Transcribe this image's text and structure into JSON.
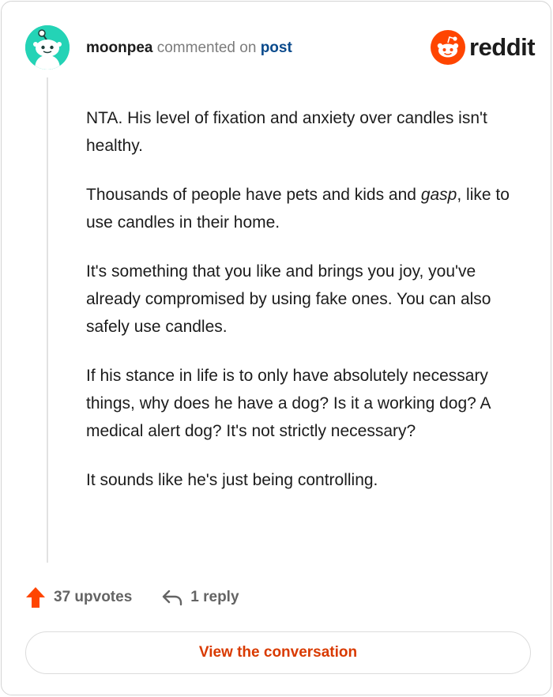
{
  "header": {
    "username": "moonpea",
    "action_text": "commented on",
    "target_link": "post",
    "brand": "reddit"
  },
  "colors": {
    "avatar_bg": "#24d3b6",
    "brand_orange": "#ff4500",
    "upvote": "#ff4500",
    "button_text": "#d93a00",
    "link": "#0a4a8c"
  },
  "icons": {
    "avatar": "snoo-avatar-icon",
    "logo": "reddit-snoo-icon",
    "upvote": "arrow-up-icon",
    "reply": "reply-arrow-icon"
  },
  "comment": {
    "p1": "NTA. His level of fixation and anxiety over candles isn't healthy.",
    "p2_pre": "Thousands of people have pets and kids and ",
    "p2_em": "gasp",
    "p2_post": ", like to use candles in their home.",
    "p3": "It's something that you like and brings you joy, you've already compromised by using fake ones. You can also safely use candles.",
    "p4": "If his stance in life is to only have absolutely necessary things, why does he have a dog? Is it a working dog? A medical alert dog? It's not strictly necessary?",
    "p5": "It sounds like he's just being controlling."
  },
  "actions": {
    "upvotes": "37 upvotes",
    "replies": "1 reply"
  },
  "cta": {
    "label": "View the conversation"
  }
}
